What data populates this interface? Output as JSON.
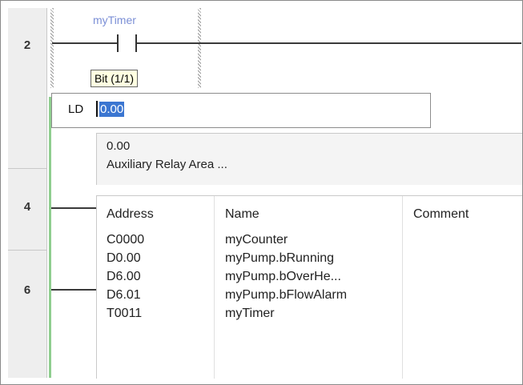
{
  "rungs": [
    "2",
    "4",
    "6"
  ],
  "contact": {
    "label": "myTimer"
  },
  "tooltip": {
    "text": "Bit (1/1)"
  },
  "ld": {
    "mnemonic": "LD",
    "selected_value": "0.00"
  },
  "info": {
    "address": "0.00",
    "area": "Auxiliary Relay Area ..."
  },
  "list": {
    "headers": {
      "address": "Address",
      "name": "Name",
      "comment": "Comment"
    },
    "rows": [
      {
        "address": "C0000",
        "name": "myCounter",
        "comment": ""
      },
      {
        "address": "D0.00",
        "name": "myPump.bRunning",
        "comment": ""
      },
      {
        "address": "D6.00",
        "name": "myPump.bOverHe...",
        "comment": ""
      },
      {
        "address": "D6.01",
        "name": "myPump.bFlowAlarm",
        "comment": ""
      },
      {
        "address": "T0011",
        "name": "myTimer",
        "comment": ""
      }
    ]
  },
  "colors": {
    "power_rail": "#8fce8f",
    "selection": "#3b76d1",
    "tooltip_bg": "#ffffe1",
    "contact_label": "#7b8fd6"
  }
}
